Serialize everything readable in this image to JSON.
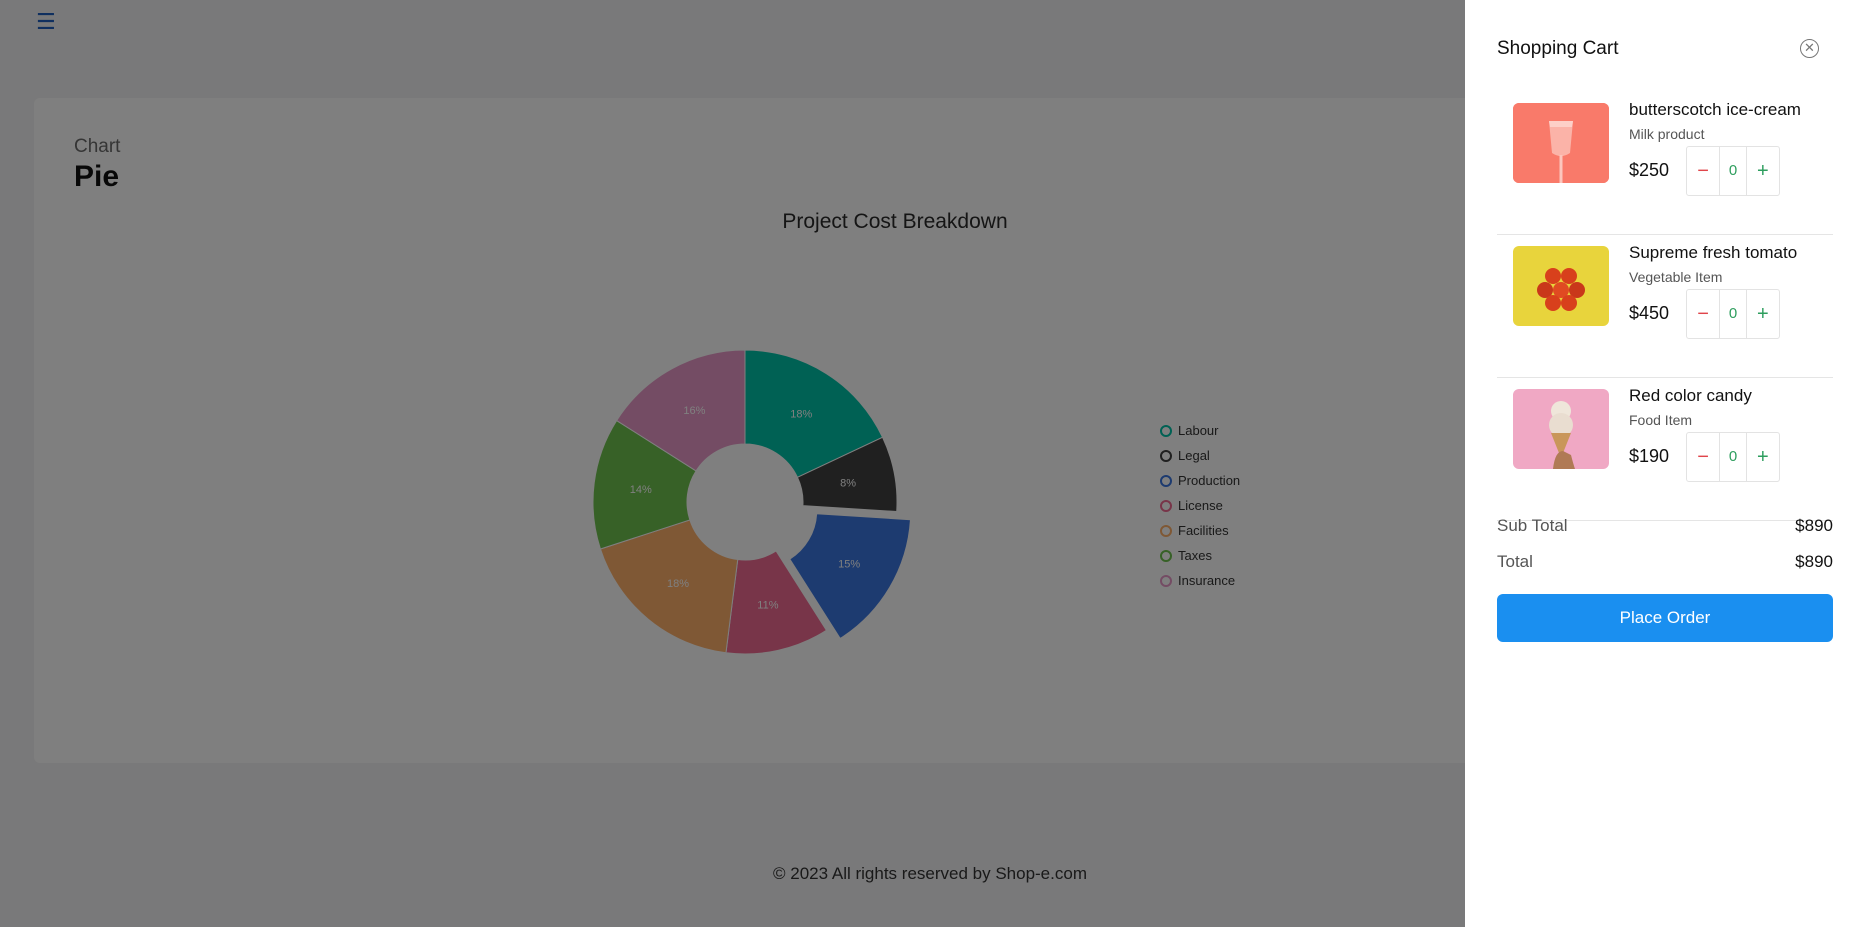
{
  "page": {
    "breadcrumb": "Chart",
    "title": "Pie",
    "footer": "© 2023 All rights reserved by Shop-e.com"
  },
  "chart_data": {
    "type": "pie",
    "title": "Project Cost Breakdown",
    "categories": [
      "Labour",
      "Legal",
      "Production",
      "License",
      "Facilities",
      "Taxes",
      "Insurance"
    ],
    "values": [
      18,
      8,
      15,
      11,
      18,
      14,
      16
    ],
    "labels": [
      "18%",
      "8%",
      "15%",
      "11%",
      "18%",
      "14%",
      "16%"
    ],
    "colors": [
      "#00c3a8",
      "#404040",
      "#3a76e0",
      "#f06b92",
      "#ffb06b",
      "#6fc24e",
      "#e899c8"
    ],
    "donut": true,
    "exploded": [
      "Production"
    ],
    "legend_position": "right"
  },
  "cart": {
    "title": "Shopping Cart",
    "items": [
      {
        "name": "butterscotch ice-cream",
        "category": "Milk product",
        "price": "$250",
        "qty": "0"
      },
      {
        "name": "Supreme fresh tomato",
        "category": "Vegetable Item",
        "price": "$450",
        "qty": "0"
      },
      {
        "name": "Red color candy",
        "category": "Food Item",
        "price": "$190",
        "qty": "0"
      }
    ],
    "subtotal_label": "Sub Total",
    "subtotal_value": "$890",
    "total_label": "Total",
    "total_value": "$890",
    "place_order_label": "Place Order",
    "minus_symbol": "−",
    "plus_symbol": "+",
    "close_symbol": "✕"
  },
  "icons": {
    "menu": "☰"
  }
}
